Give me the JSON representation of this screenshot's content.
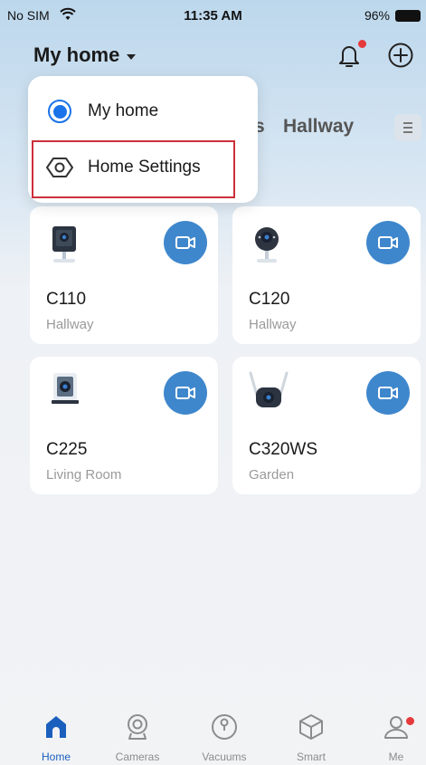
{
  "status_bar": {
    "carrier": "No SIM",
    "time": "11:35 AM",
    "battery": "96%"
  },
  "header": {
    "home_name": "My home"
  },
  "home_tabs": {
    "partial": "s",
    "hallway": "Hallway"
  },
  "dropdown": {
    "items": [
      {
        "label": "My home",
        "selected": true
      },
      {
        "label": "Home Settings",
        "selected": false
      }
    ]
  },
  "devices": [
    {
      "name": "C110",
      "room": "Hallway",
      "icon": "c110-camera-icon"
    },
    {
      "name": "C120",
      "room": "Hallway",
      "icon": "c120-camera-icon"
    },
    {
      "name": "C225",
      "room": "Living Room",
      "icon": "c225-camera-icon"
    },
    {
      "name": "C320WS",
      "room": "Garden",
      "icon": "c320ws-camera-icon"
    }
  ],
  "tabbar": {
    "items": [
      {
        "label": "Home",
        "active": true
      },
      {
        "label": "Cameras",
        "active": false
      },
      {
        "label": "Vacuums",
        "active": false
      },
      {
        "label": "Smart",
        "active": false
      },
      {
        "label": "Me",
        "active": false
      }
    ]
  },
  "colors": {
    "accent": "#3f87cc",
    "active_tab": "#1a5fbd",
    "notify_dot": "#e5393b",
    "highlight": "#cc2f3a"
  }
}
